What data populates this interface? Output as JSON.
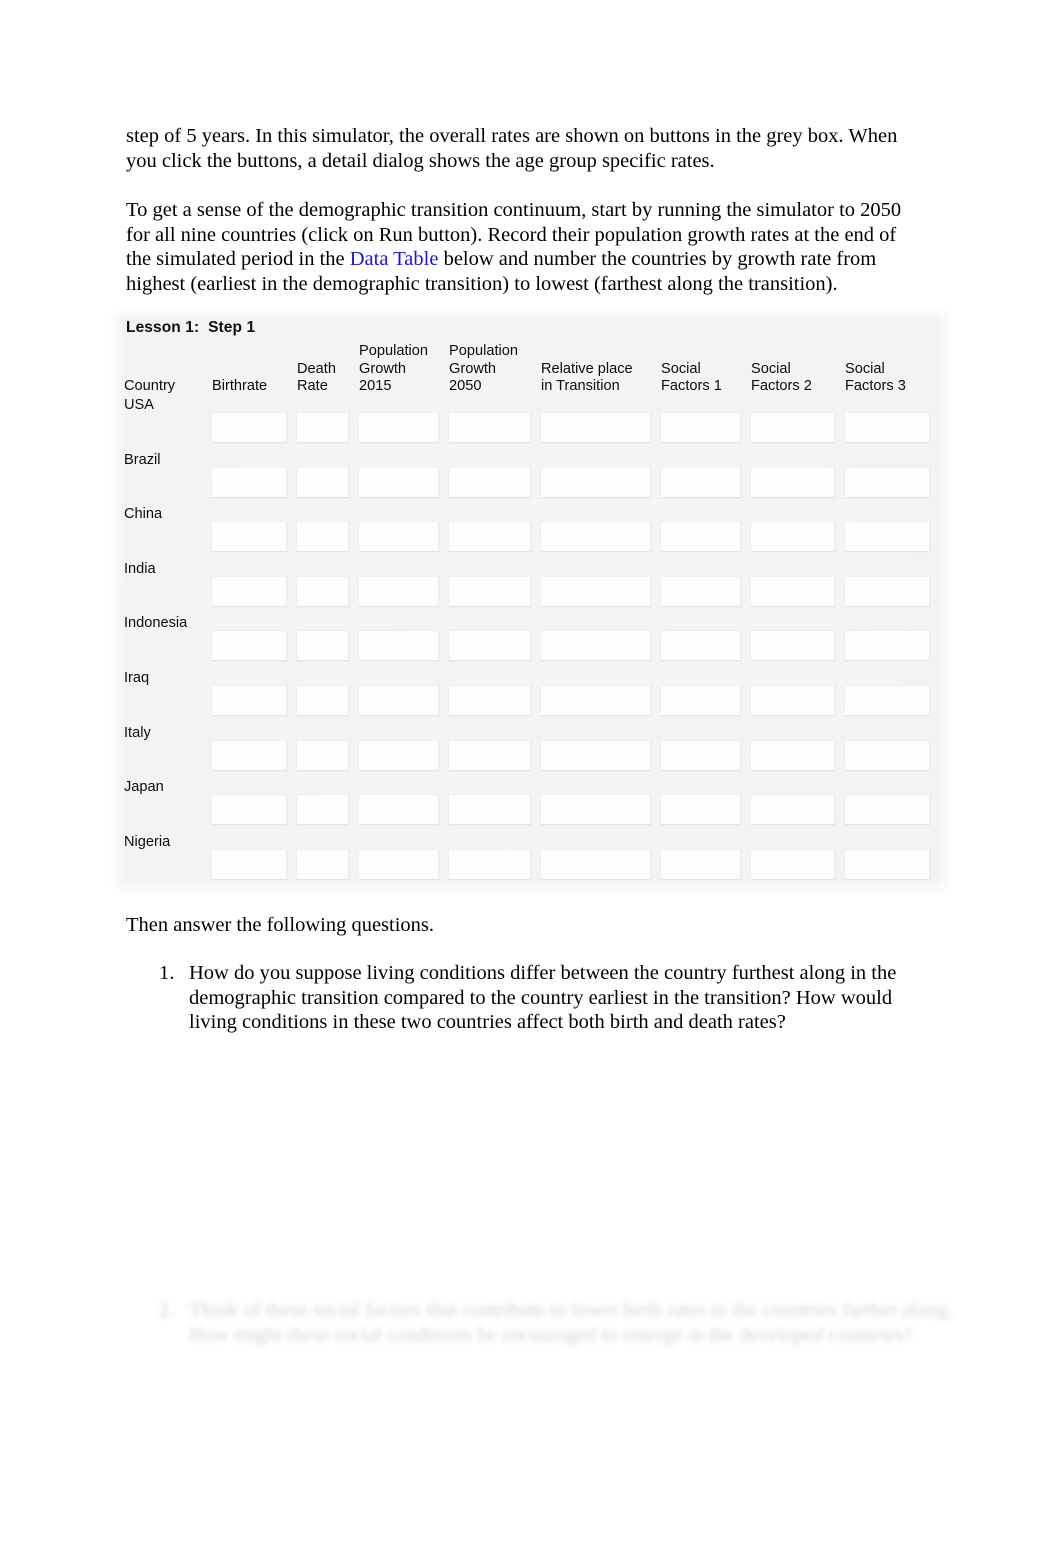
{
  "document": {
    "paragraphs": [
      "step of 5 years. In this simulator, the overall rates are shown on buttons in the grey box. When you click the buttons, a detail dialog shows the age group specific rates.",
      {
        "before_link": "To get a sense of the demographic transition continuum, start by running the simulator to 2050 for all nine countries (click on Run button). Record their population growth rates at the end of the simulated period in the ",
        "link": "Data Table",
        "after_link": " below and number the countries by growth rate from highest (earliest in the demographic transition) to lowest (farthest along the transition)."
      },
      "Then answer the following questions."
    ],
    "link_color": "#1a13e8"
  },
  "data_table": {
    "title": "Lesson 1:  Step 1",
    "columns": [
      "Country",
      "Birthrate",
      "Death\nRate",
      "Population\nGrowth\n2015",
      "Population\nGrowth\n2050",
      "Relative place\nin Transition",
      "Social\nFactors 1",
      "Social\nFactors 2",
      "Social\nFactors 3"
    ],
    "rows": [
      {
        "country": "USA",
        "birthrate": "",
        "death_rate": "",
        "pop_growth_2015": "",
        "pop_growth_2050": "",
        "relative_place": "",
        "social_1": "",
        "social_2": "",
        "social_3": ""
      },
      {
        "country": "Brazil",
        "birthrate": "",
        "death_rate": "",
        "pop_growth_2015": "",
        "pop_growth_2050": "",
        "relative_place": "",
        "social_1": "",
        "social_2": "",
        "social_3": ""
      },
      {
        "country": "China",
        "birthrate": "",
        "death_rate": "",
        "pop_growth_2015": "",
        "pop_growth_2050": "",
        "relative_place": "",
        "social_1": "",
        "social_2": "",
        "social_3": ""
      },
      {
        "country": "India",
        "birthrate": "",
        "death_rate": "",
        "pop_growth_2015": "",
        "pop_growth_2050": "",
        "relative_place": "",
        "social_1": "",
        "social_2": "",
        "social_3": ""
      },
      {
        "country": "Indonesia",
        "birthrate": "",
        "death_rate": "",
        "pop_growth_2015": "",
        "pop_growth_2050": "",
        "relative_place": "",
        "social_1": "",
        "social_2": "",
        "social_3": ""
      },
      {
        "country": "Iraq",
        "birthrate": "",
        "death_rate": "",
        "pop_growth_2015": "",
        "pop_growth_2050": "",
        "relative_place": "",
        "social_1": "",
        "social_2": "",
        "social_3": ""
      },
      {
        "country": "Italy",
        "birthrate": "",
        "death_rate": "",
        "pop_growth_2015": "",
        "pop_growth_2050": "",
        "relative_place": "",
        "social_1": "",
        "social_2": "",
        "social_3": ""
      },
      {
        "country": "Japan",
        "birthrate": "",
        "death_rate": "",
        "pop_growth_2015": "",
        "pop_growth_2050": "",
        "relative_place": "",
        "social_1": "",
        "social_2": "",
        "social_3": ""
      },
      {
        "country": "Nigeria",
        "birthrate": "",
        "death_rate": "",
        "pop_growth_2015": "",
        "pop_growth_2050": "",
        "relative_place": "",
        "social_1": "",
        "social_2": "",
        "social_3": ""
      }
    ]
  },
  "questions": [
    {
      "marker": "1.",
      "text": "How do you suppose living conditions differ between the country furthest along in the demographic transition compared to the country earliest in the transition? How would living conditions in these two countries affect both birth and death rates?"
    },
    {
      "marker": "2.",
      "text": "Think of these social factors that contribute to lower birth rates in the countries farther along. How might these social conditions be encouraged to emerge in the developed countries?",
      "illegible": true
    }
  ]
}
